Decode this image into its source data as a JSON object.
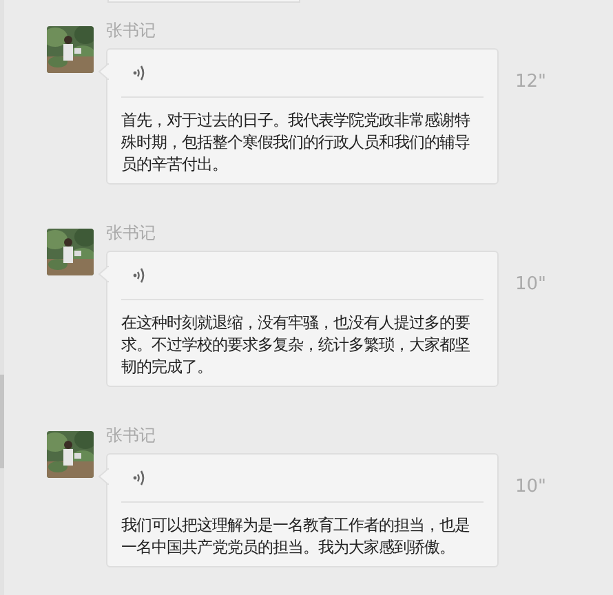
{
  "messages": [
    {
      "sender": "张书记",
      "duration": "12\"",
      "text": "首先，对于过去的日子。我代表学院党政非常感谢特殊时期，包括整个寒假我们的行政人员和我们的辅导员的辛苦付出。"
    },
    {
      "sender": "张书记",
      "duration": "10\"",
      "text": "在这种时刻就退缩，没有牢骚，也没有人提过多的要求。不过学校的要求多复杂，统计多繁琐，大家都坚韧的完成了。"
    },
    {
      "sender": "张书记",
      "duration": "10\"",
      "text": "我们可以把这理解为是一名教育工作者的担当，也是一名中国共产党党员的担当。我为大家感到骄傲。"
    }
  ]
}
